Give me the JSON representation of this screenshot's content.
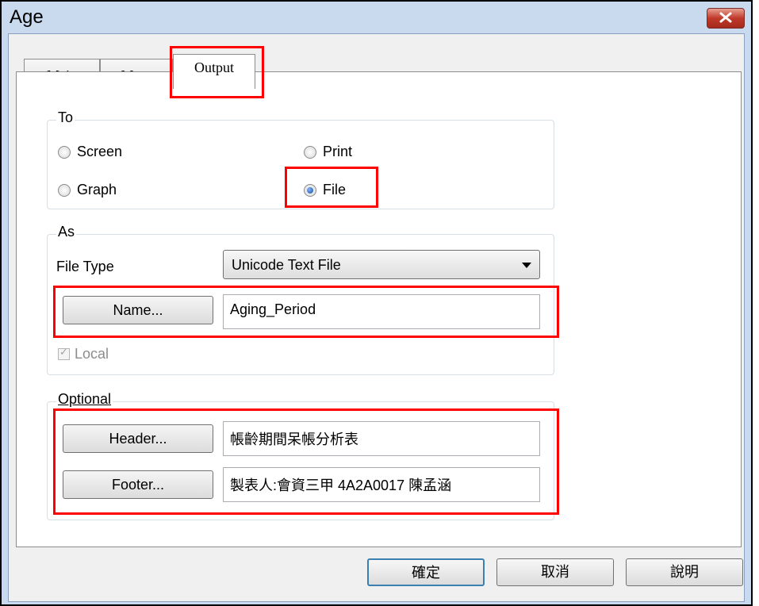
{
  "window": {
    "title": "Age"
  },
  "tabs": [
    {
      "label": "Main"
    },
    {
      "label": "More"
    },
    {
      "label": "Output"
    }
  ],
  "to_group": {
    "legend": "To",
    "options": [
      {
        "label": "Screen",
        "selected": false
      },
      {
        "label": "Print",
        "selected": false
      },
      {
        "label": "Graph",
        "selected": false
      },
      {
        "label": "File",
        "selected": true
      }
    ]
  },
  "as_group": {
    "legend": "As",
    "file_type_label": "File Type",
    "file_type_value": "Unicode Text File",
    "name_button": "Name...",
    "name_value": "Aging_Period",
    "local_label": "Local",
    "local_checked": true
  },
  "optional_group": {
    "legend": "Optional",
    "header_button": "Header...",
    "header_value": "帳齡期間呆帳分析表",
    "footer_button": "Footer...",
    "footer_value": "製表人:會資三甲 4A2A0017 陳孟涵"
  },
  "buttons": {
    "ok": "確定",
    "cancel": "取消",
    "help": "說明"
  },
  "colors": {
    "highlight": "#ff0000",
    "default_button_border": "#3c7fb1"
  }
}
